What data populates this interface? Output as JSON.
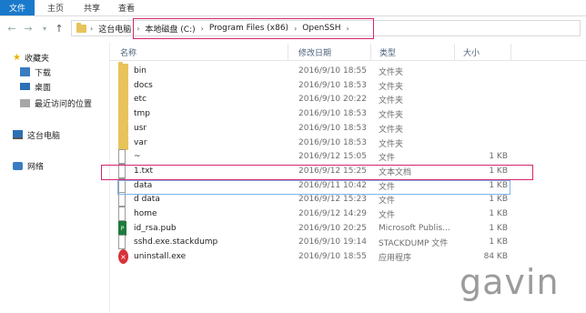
{
  "ribbon": {
    "tabs": [
      "文件",
      "主页",
      "共享",
      "查看"
    ]
  },
  "address": {
    "crumbs": [
      "这台电脑",
      "本地磁盘 (C:)",
      "Program Files (x86)",
      "OpenSSH"
    ]
  },
  "nav": {
    "favorites_label": "收藏夹",
    "favorites": [
      "下载",
      "桌面",
      "最近访问的位置"
    ],
    "pc_label": "这台电脑",
    "network_label": "网络"
  },
  "columns": {
    "name": "名称",
    "date": "修改日期",
    "type": "类型",
    "size": "大小"
  },
  "files": [
    {
      "name": "bin",
      "date": "2016/9/10 18:55",
      "type": "文件夹",
      "size": "",
      "icon": "folder-icon"
    },
    {
      "name": "docs",
      "date": "2016/9/10 18:53",
      "type": "文件夹",
      "size": "",
      "icon": "folder-icon"
    },
    {
      "name": "etc",
      "date": "2016/9/10 20:22",
      "type": "文件夹",
      "size": "",
      "icon": "folder-icon"
    },
    {
      "name": "tmp",
      "date": "2016/9/10 18:53",
      "type": "文件夹",
      "size": "",
      "icon": "folder-icon"
    },
    {
      "name": "usr",
      "date": "2016/9/10 18:53",
      "type": "文件夹",
      "size": "",
      "icon": "folder-icon"
    },
    {
      "name": "var",
      "date": "2016/9/10 18:53",
      "type": "文件夹",
      "size": "",
      "icon": "folder-icon"
    },
    {
      "name": "~",
      "date": "2016/9/12 15:05",
      "type": "文件",
      "size": "1 KB",
      "icon": "file-icon"
    },
    {
      "name": "1.txt",
      "date": "2016/9/12 15:25",
      "type": "文本文档",
      "size": "1 KB",
      "icon": "text-file-icon"
    },
    {
      "name": "data",
      "date": "2016/9/11 10:42",
      "type": "文件",
      "size": "1 KB",
      "icon": "file-icon"
    },
    {
      "name": "d    data",
      "date": "2016/9/12 15:23",
      "type": "文件",
      "size": "1 KB",
      "icon": "file-icon"
    },
    {
      "name": "home",
      "date": "2016/9/12 14:29",
      "type": "文件",
      "size": "1 KB",
      "icon": "file-icon"
    },
    {
      "name": "id_rsa.pub",
      "date": "2016/9/10 20:25",
      "type": "Microsoft Publis...",
      "size": "1 KB",
      "icon": "publisher-file-icon"
    },
    {
      "name": "sshd.exe.stackdump",
      "date": "2016/9/10 19:14",
      "type": "STACKDUMP 文件",
      "size": "1 KB",
      "icon": "file-icon"
    },
    {
      "name": "uninstall.exe",
      "date": "2016/9/10 18:55",
      "type": "应用程序",
      "size": "84 KB",
      "icon": "exe-icon"
    }
  ],
  "watermark": "gavin",
  "colors": {
    "accent": "#1979ca",
    "highlight": "#d6246e"
  }
}
